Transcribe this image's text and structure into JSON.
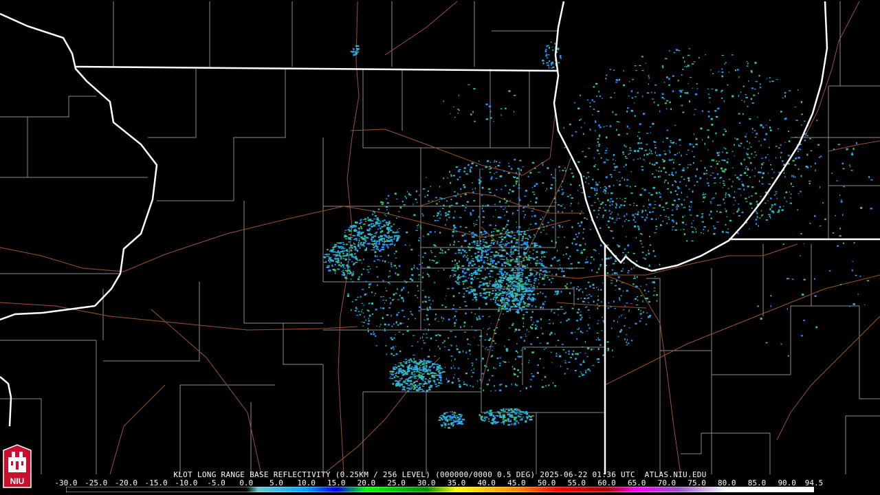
{
  "product": {
    "caption": "KLOT LONG RANGE BASE REFLECTIVITY (0.25KM / 256 LEVEL) (000000/0000 0.5 DEG) 2025-06-22 01:36 UTC  ATLAS.NIU.EDU"
  },
  "logo": {
    "text": "NIU"
  },
  "colorbar": {
    "ticks": [
      "-30.0",
      "-25.0",
      "-20.0",
      "-15.0",
      "-10.0",
      "-5.0",
      "0.0",
      "5.0",
      "10.0",
      "15.0",
      "20.0",
      "25.0",
      "30.0",
      "35.0",
      "40.0",
      "45.0",
      "50.0",
      "55.0",
      "60.0",
      "65.0",
      "70.0",
      "75.0",
      "80.0",
      "85.0",
      "90.0",
      "94.5"
    ],
    "min": -30.0,
    "max": 94.5,
    "stops": [
      {
        "v": -30,
        "c": "#000000"
      },
      {
        "v": 0,
        "c": "#000000"
      },
      {
        "v": 2,
        "c": "#66cccc"
      },
      {
        "v": 10,
        "c": "#00a0ff"
      },
      {
        "v": 15,
        "c": "#0000ee"
      },
      {
        "v": 20,
        "c": "#00ff00"
      },
      {
        "v": 30,
        "c": "#009000"
      },
      {
        "v": 35,
        "c": "#ffff00"
      },
      {
        "v": 45,
        "c": "#ff8c00"
      },
      {
        "v": 52,
        "c": "#ff0000"
      },
      {
        "v": 60,
        "c": "#b00000"
      },
      {
        "v": 65,
        "c": "#ff00ff"
      },
      {
        "v": 72,
        "c": "#9955c9"
      },
      {
        "v": 80,
        "c": "#ffffff"
      },
      {
        "v": 94.5,
        "c": "#ffffff"
      }
    ]
  },
  "colors": {
    "background": "#000000",
    "county_lines": "#8c8c8c",
    "state_lines": "#ffffff",
    "highways": "#a0522d",
    "echo_light": "#33bbcc",
    "echo_medium": "#1e90ff",
    "echo_green": "#33cc66"
  }
}
